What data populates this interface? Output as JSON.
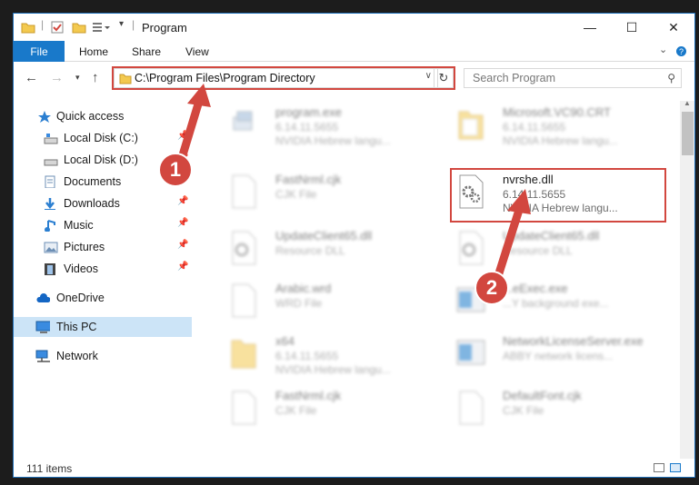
{
  "window": {
    "title": "Program",
    "controls": {
      "minimize": "—",
      "maximize": "☐",
      "close": "✕"
    }
  },
  "ribbon": {
    "tabs": [
      "File",
      "Home",
      "Share",
      "View"
    ],
    "expand_icon": "chevron-down-icon",
    "help_icon": "help-icon"
  },
  "address": {
    "path": "C:\\Program Files\\Program Directory"
  },
  "search": {
    "placeholder": "Search Program"
  },
  "sidebar": {
    "items": [
      {
        "label": "Quick access",
        "icon": "star-icon"
      },
      {
        "label": "Local Disk (C:)",
        "icon": "drive-icon"
      },
      {
        "label": "Local Disk (D:)",
        "icon": "drive-icon"
      },
      {
        "label": "Documents",
        "icon": "documents-icon"
      },
      {
        "label": "Downloads",
        "icon": "downloads-icon"
      },
      {
        "label": "Music",
        "icon": "music-icon"
      },
      {
        "label": "Pictures",
        "icon": "pictures-icon"
      },
      {
        "label": "Videos",
        "icon": "videos-icon"
      },
      {
        "label": "OneDrive",
        "icon": "cloud-icon"
      },
      {
        "label": "This PC",
        "icon": "computer-icon"
      },
      {
        "label": "Network",
        "icon": "network-icon"
      }
    ]
  },
  "files": [
    {
      "name": "program.exe",
      "line2": "6.14.11.5655",
      "line3": "NVIDIA Hebrew langu..."
    },
    {
      "name": "Microsoft.VC90.CRT",
      "line2": "6.14.11.5655",
      "line3": "NVIDIA Hebrew langu..."
    },
    {
      "name": "FastNrml.cjk",
      "line2": "CJK File",
      "line3": ""
    },
    {
      "name": "nvrshe.dll",
      "line2": "6.14.11.5655",
      "line3": "NVIDIA Hebrew langu..."
    },
    {
      "name": "UpdateClient65.dll",
      "line2": "Resource DLL",
      "line3": ""
    },
    {
      "name": "UpdateClient65.dll",
      "line2": "Resource DLL",
      "line3": ""
    },
    {
      "name": "Arabic.wrd",
      "line2": "WRD File",
      "line3": ""
    },
    {
      "name": "...eExec.exe",
      "line2": "...Y background exe...",
      "line3": ""
    },
    {
      "name": "x64",
      "line2": "6.14.11.5655",
      "line3": "NVIDIA Hebrew langu..."
    },
    {
      "name": "NetworkLicenseServer.exe",
      "line2": "ABBY network licens...",
      "line3": ""
    },
    {
      "name": "FastNrml.cjk",
      "line2": "CJK File",
      "line3": ""
    },
    {
      "name": "DefaultFont.cjk",
      "line2": "CJK File",
      "line3": ""
    }
  ],
  "status": {
    "item_count": "111 items"
  },
  "callouts": [
    "1",
    "2"
  ],
  "colors": {
    "accent": "#1979ca",
    "highlight": "#d2473f",
    "selected": "#cce4f7"
  }
}
